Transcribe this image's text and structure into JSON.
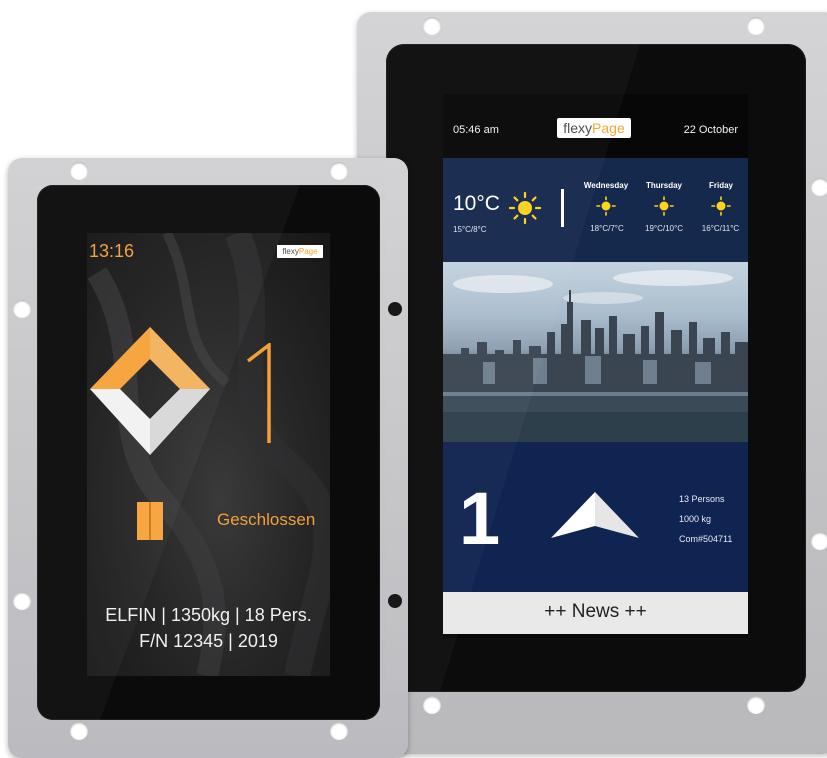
{
  "right_display": {
    "time": "05:46 am",
    "logo": {
      "part1": "flexy",
      "part2": "Page"
    },
    "date": "22 October",
    "weather": {
      "current_temp": "10°C",
      "current_range": "15°C/8°C",
      "icon": "sun-icon",
      "forecast": [
        {
          "day": "Wednesday",
          "range": "18°C/7°C",
          "icon": "sun-icon"
        },
        {
          "day": "Thursday",
          "range": "19°C/10°C",
          "icon": "sun-icon"
        },
        {
          "day": "Friday",
          "range": "16°C/11°C",
          "icon": "sun-icon"
        }
      ]
    },
    "image": "city-skyline-photo",
    "floor": "1",
    "direction_icon": "arrow-up-icon",
    "stats": [
      "13 Persons",
      "1000 kg",
      "Com#504711"
    ],
    "news": "++ News ++"
  },
  "left_display": {
    "time": "13:16",
    "logo": {
      "part1": "flexy",
      "part2": "Page"
    },
    "floor": "1",
    "status": "Geschlossen",
    "info_line1": "ELFIN | 1350kg | 18 Pers.",
    "info_line2": "F/N 12345 | 2019"
  },
  "colors": {
    "accent_orange": "#f4a531",
    "navy": "#15294d",
    "navy_dark": "#0f2450"
  }
}
